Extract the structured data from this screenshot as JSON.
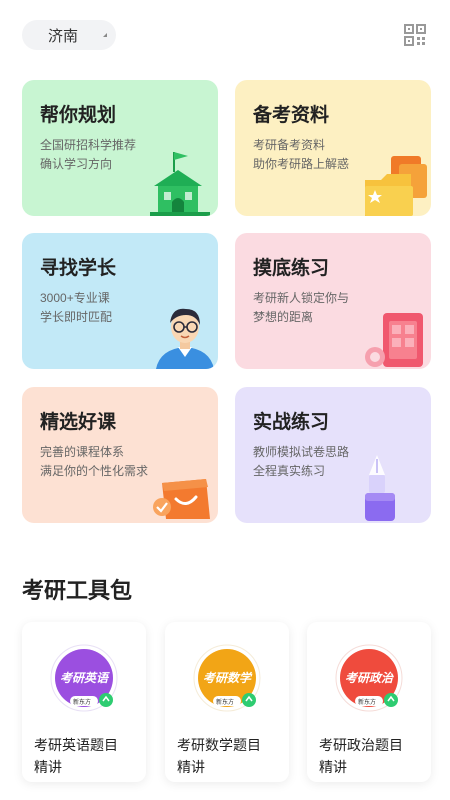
{
  "header": {
    "city": "济南",
    "qr_icon": "qr-code-icon"
  },
  "cards": [
    {
      "title": "帮你规划",
      "line1": "全国研招科学推荐",
      "line2": "确认学习方向",
      "icon": "school-building-icon",
      "color": "#c8f5d2"
    },
    {
      "title": "备考资料",
      "line1": "考研备考资料",
      "line2": "助你考研路上解惑",
      "icon": "folder-star-icon",
      "color": "#fdf0c2"
    },
    {
      "title": "寻找学长",
      "line1": "3000+专业课",
      "line2": "学长即时匹配",
      "icon": "senior-avatar-icon",
      "color": "#c2e9f7"
    },
    {
      "title": "摸底练习",
      "line1": "考研新人锁定你与",
      "line2": "梦想的距离",
      "icon": "clipboard-icon",
      "color": "#fbdbe1"
    },
    {
      "title": "精选好课",
      "line1": "完善的课程体系",
      "line2": "满足你的个性化需求",
      "icon": "shopping-bag-icon",
      "color": "#fde1d3"
    },
    {
      "title": "实战练习",
      "line1": "教师模拟试卷思路",
      "line2": "全程真实练习",
      "icon": "fountain-pen-icon",
      "color": "#e6e1fb"
    }
  ],
  "toolkit": {
    "title": "考研工具包",
    "items": [
      {
        "badge": "考研英语",
        "brand": "新东方",
        "line1": "考研英语题目",
        "line2": "精讲",
        "color": "#9b4fe0"
      },
      {
        "badge": "考研数学",
        "brand": "新东方",
        "line1": "考研数学题目",
        "line2": "精讲",
        "color": "#f2a516"
      },
      {
        "badge": "考研政治",
        "brand": "新东方",
        "line1": "考研政治题目",
        "line2": "精讲",
        "color": "#ef4b3d"
      }
    ]
  }
}
